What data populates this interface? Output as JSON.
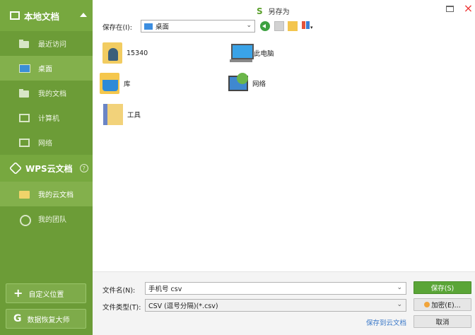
{
  "sidebar": {
    "local_header": "本地文档",
    "items": [
      {
        "label": "最近访问"
      },
      {
        "label": "桌面"
      },
      {
        "label": "我的文档"
      },
      {
        "label": "计算机"
      },
      {
        "label": "网络"
      }
    ],
    "cloud_header": "WPS云文档",
    "help": "?",
    "cloud_items": [
      {
        "label": "我的云文档"
      },
      {
        "label": "我的团队"
      }
    ],
    "custom_location": "自定义位置",
    "recovery": "数据恢复大师"
  },
  "titlebar": {
    "logo": "S",
    "title": "另存为",
    "close": "×"
  },
  "savein": {
    "label": "保存在(I):",
    "value": "桌面"
  },
  "files": [
    {
      "name": "15340"
    },
    {
      "name": "此电脑"
    },
    {
      "name": "库"
    },
    {
      "name": "网络"
    },
    {
      "name": "工具"
    }
  ],
  "bottom": {
    "filename_label": "文件名(N):",
    "filename_value": "手机号 csv",
    "filetype_label": "文件类型(T):",
    "filetype_value": "CSV (逗号分隔)(*.csv)",
    "save_to_cloud": "保存到云文档",
    "save_button": "保存(S)",
    "encrypt_button": "加密(E)...",
    "cancel_button": "取消"
  },
  "colors": {
    "sidebar": "#6c9c37",
    "accent": "#5aa537",
    "link": "#3b79c9"
  }
}
